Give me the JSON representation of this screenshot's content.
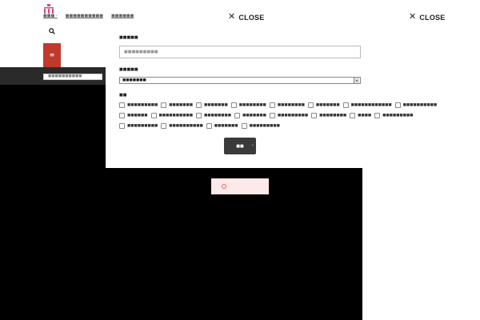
{
  "header": {
    "nav": [
      "■■■ ›",
      "■■■■■■■■■■",
      "■■■■■■"
    ]
  },
  "sidebar_search": {
    "placeholder": "■■■■■■■■■■"
  },
  "modal": {
    "close_label": "CLOSE",
    "keyword_label": "■■■■■",
    "keyword_placeholder": "■■■■■■■■■",
    "category_label": "■■■■■",
    "category_selected": "■■■■■■■",
    "tags_label": "■■",
    "checkbox_rows": [
      [
        "■■■■■■■■■",
        "■■■■■■■",
        "■■■■■■■",
        "■■■■■■■■",
        "■■■■■■■■",
        "■■■■■■■",
        "■■■■■■■■■■■■",
        "■■■■■■■■■■"
      ],
      [
        "■■■■■■",
        "■■■■■■■■■■",
        "■■■■■■■■",
        "■■■■■■■",
        "■■■■■■■■■",
        "■■■■■■■■",
        "■■■■",
        "■■■■■■■■■"
      ],
      [
        "■■■■■■■■■",
        "■■■■■■■■■■",
        "■■■■■■■",
        "■■■■■■■■■"
      ]
    ],
    "submit_label": "■■"
  },
  "outer_close_label": "CLOSE",
  "colors": {
    "menu": "#c0392b",
    "backdrop": "#000000",
    "notice": "#fde8ea"
  }
}
